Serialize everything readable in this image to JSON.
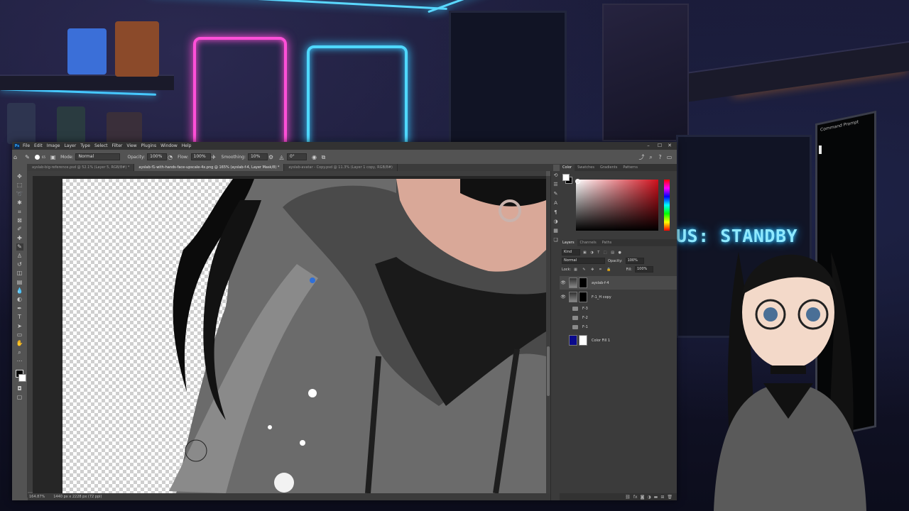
{
  "background": {
    "standby_text": "US: STANDBY",
    "terminal_title": "Command Prompt",
    "neon_accent": "#37c9ff",
    "neon_pink": "#ff4fd8"
  },
  "app": {
    "logo": "Ps",
    "menus": [
      "File",
      "Edit",
      "Image",
      "Layer",
      "Type",
      "Select",
      "Filter",
      "View",
      "Plugins",
      "Window",
      "Help"
    ],
    "window_controls": [
      "–",
      "☐",
      "✕"
    ]
  },
  "options": {
    "mode_label": "Mode:",
    "mode_value": "Normal",
    "opacity_label": "Opacity:",
    "opacity_value": "100%",
    "flow_label": "Flow:",
    "flow_value": "100%",
    "smoothing_label": "Smoothing:",
    "smoothing_value": "10%",
    "angle_value": "0°",
    "brush_size": "65"
  },
  "tabs": [
    {
      "label": "ayslab-big-reference.psd @ 52.1% (Layer 5, RGB/8#) *",
      "active": false
    },
    {
      "label": "ayslab-f1-with-hands-face-upscale-4x.png @ 165% (ayslab-f-4, Layer Mask/8) *",
      "active": true
    },
    {
      "label": "ayslab-avatar - Copy.psd @ 11.3% (Layer 1 copy, RGB/8#)",
      "active": false
    }
  ],
  "status": {
    "zoom": "164.87%",
    "doc_size": "1440 px x 2228 px (72 ppi)"
  },
  "color_panel": {
    "tabs": [
      "Color",
      "Swatches",
      "Gradients",
      "Patterns"
    ],
    "foreground": "#ffffff",
    "background": "#000000",
    "hue_color": "#d0101c"
  },
  "layers_panel": {
    "tabs": [
      "Layers",
      "Channels",
      "Paths"
    ],
    "kind_label": "Kind",
    "blend_mode": "Normal",
    "opacity_label": "Opacity:",
    "opacity_value": "100%",
    "lock_label": "Lock:",
    "fill_label": "Fill:",
    "fill_value": "100%",
    "layers": [
      {
        "name": "ayslab-f-4",
        "visible": true,
        "selected": true,
        "type": "image-mask"
      },
      {
        "name": "F-1_H copy",
        "visible": true,
        "selected": false,
        "type": "image-mask"
      },
      {
        "name": "F-3",
        "visible": false,
        "selected": false,
        "type": "folder"
      },
      {
        "name": "F-2",
        "visible": false,
        "selected": false,
        "type": "folder"
      },
      {
        "name": "F-1",
        "visible": false,
        "selected": false,
        "type": "folder"
      },
      {
        "name": "Color Fill 1",
        "visible": false,
        "selected": false,
        "type": "fill",
        "fill_color": "#0a0a8c"
      }
    ]
  }
}
